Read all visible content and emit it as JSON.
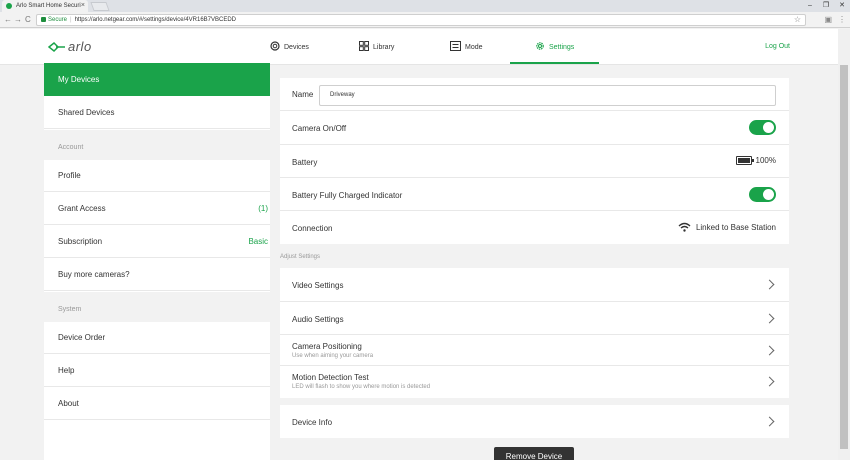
{
  "browser": {
    "tab_title": "Arlo Smart Home Securi",
    "tab_close": "×",
    "secure_label": "Secure",
    "url": "https://arlo.netgear.com/#/settings/device/4VR16B7VBCEDD",
    "back": "←",
    "forward": "→",
    "reload": "C",
    "star": "☆",
    "window_minimize": "–",
    "window_restore": "❐",
    "window_close": "✕",
    "menu": "⋮"
  },
  "header": {
    "logo_text": "arlo",
    "nav": [
      {
        "label": "Devices",
        "icon": "devices-icon"
      },
      {
        "label": "Library",
        "icon": "library-icon"
      },
      {
        "label": "Mode",
        "icon": "mode-icon"
      },
      {
        "label": "Settings",
        "icon": "settings-gear-icon",
        "active": true
      }
    ],
    "logout": "Log Out",
    "accent_color": "#1aa34a"
  },
  "sidebar": {
    "items": [
      {
        "label": "My Devices",
        "active": true
      },
      {
        "label": "Shared Devices"
      }
    ],
    "account_header": "Account",
    "account_items": [
      {
        "label": "Profile"
      },
      {
        "label": "Grant Access",
        "value": "(1)"
      },
      {
        "label": "Subscription",
        "value": "Basic"
      },
      {
        "label": "Buy more cameras?"
      }
    ],
    "system_header": "System",
    "system_items": [
      {
        "label": "Device Order"
      },
      {
        "label": "Help"
      },
      {
        "label": "About"
      }
    ]
  },
  "device": {
    "name_label": "Name",
    "name_value": "Driveway",
    "camera_onoff_label": "Camera On/Off",
    "camera_on": true,
    "battery_label": "Battery",
    "battery_value": "100%",
    "battery_indicator_label": "Battery Fully Charged Indicator",
    "battery_indicator_on": true,
    "connection_label": "Connection",
    "connection_value": "Linked to Base Station"
  },
  "adjust": {
    "header": "Adjust Settings",
    "video": "Video Settings",
    "audio": "Audio Settings",
    "positioning": "Camera Positioning",
    "positioning_sub": "Use when aiming your camera",
    "motion": "Motion Detection Test",
    "motion_sub": "LED will flash to show you where motion is detected"
  },
  "device_info": "Device Info",
  "remove_button": "Remove Device"
}
